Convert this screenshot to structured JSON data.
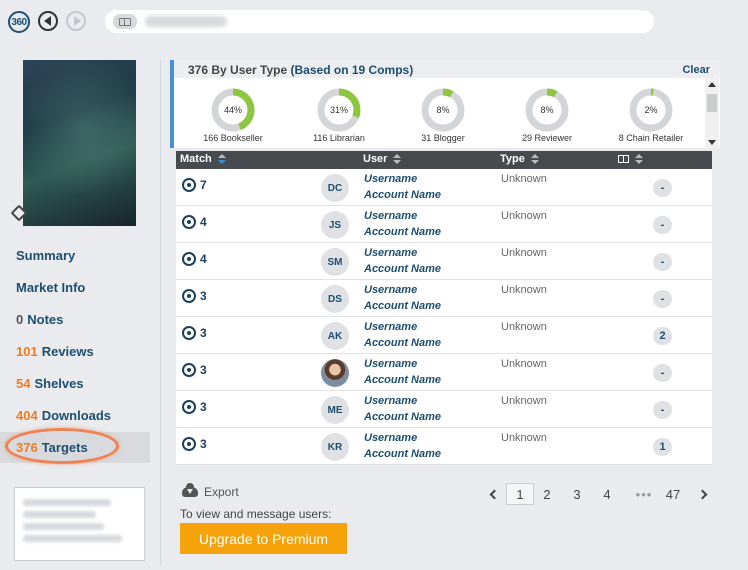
{
  "topbar": {
    "logo": "360",
    "back_icon": "arrow-left-icon",
    "forward_icon": "arrow-right-icon",
    "search_icon": "book-icon"
  },
  "sidebar": {
    "items": [
      {
        "count": "",
        "label": "Summary"
      },
      {
        "count": "",
        "label": "Market Info"
      },
      {
        "count": "0",
        "label": "Notes"
      },
      {
        "count": "101",
        "label": "Reviews"
      },
      {
        "count": "54",
        "label": "Shelves"
      },
      {
        "count": "404",
        "label": "Downloads"
      },
      {
        "count": "376",
        "label": "Targets"
      }
    ],
    "active": "Targets"
  },
  "type_summary": {
    "title": "376 By User Type",
    "basis": "(Based on 19 Comps)",
    "clear_label": "Clear",
    "accent_color": "#8dc63f",
    "segments": [
      {
        "pct": 44,
        "pct_label": "44%",
        "label": "166 Bookseller"
      },
      {
        "pct": 31,
        "pct_label": "31%",
        "label": "116 Librarian"
      },
      {
        "pct": 8,
        "pct_label": "8%",
        "label": "31 Blogger"
      },
      {
        "pct": 8,
        "pct_label": "8%",
        "label": "29 Reviewer"
      },
      {
        "pct": 2,
        "pct_label": "2%",
        "label": "8 Chain Retailer"
      }
    ]
  },
  "table": {
    "headers": {
      "match": "Match",
      "user": "User",
      "type": "Type"
    },
    "rows": [
      {
        "match": "7",
        "initials": "DC",
        "username": "Username",
        "account": "Account Name",
        "type": "Unknown",
        "badge": "-"
      },
      {
        "match": "4",
        "initials": "JS",
        "username": "Username",
        "account": "Account Name",
        "type": "Unknown",
        "badge": "-"
      },
      {
        "match": "4",
        "initials": "SM",
        "username": "Username",
        "account": "Account Name",
        "type": "Unknown",
        "badge": "-"
      },
      {
        "match": "3",
        "initials": "DS",
        "username": "Username",
        "account": "Account Name",
        "type": "Unknown",
        "badge": "-"
      },
      {
        "match": "3",
        "initials": "AK",
        "username": "Username",
        "account": "Account Name",
        "type": "Unknown",
        "badge": "2"
      },
      {
        "match": "3",
        "initials": "",
        "username": "Username",
        "account": "Account Name",
        "type": "Unknown",
        "badge": "-"
      },
      {
        "match": "3",
        "initials": "ME",
        "username": "Username",
        "account": "Account Name",
        "type": "Unknown",
        "badge": "-"
      },
      {
        "match": "3",
        "initials": "KR",
        "username": "Username",
        "account": "Account Name",
        "type": "Unknown",
        "badge": "1"
      }
    ]
  },
  "footer": {
    "export_label": "Export",
    "hint": "To view and message users:",
    "upgrade_label": "Upgrade to Premium",
    "upgrade_color": "#f6a20a"
  },
  "pager": {
    "pages": [
      "1",
      "2",
      "3",
      "4"
    ],
    "ellipsis": "•••",
    "last": "47",
    "current": "1"
  }
}
